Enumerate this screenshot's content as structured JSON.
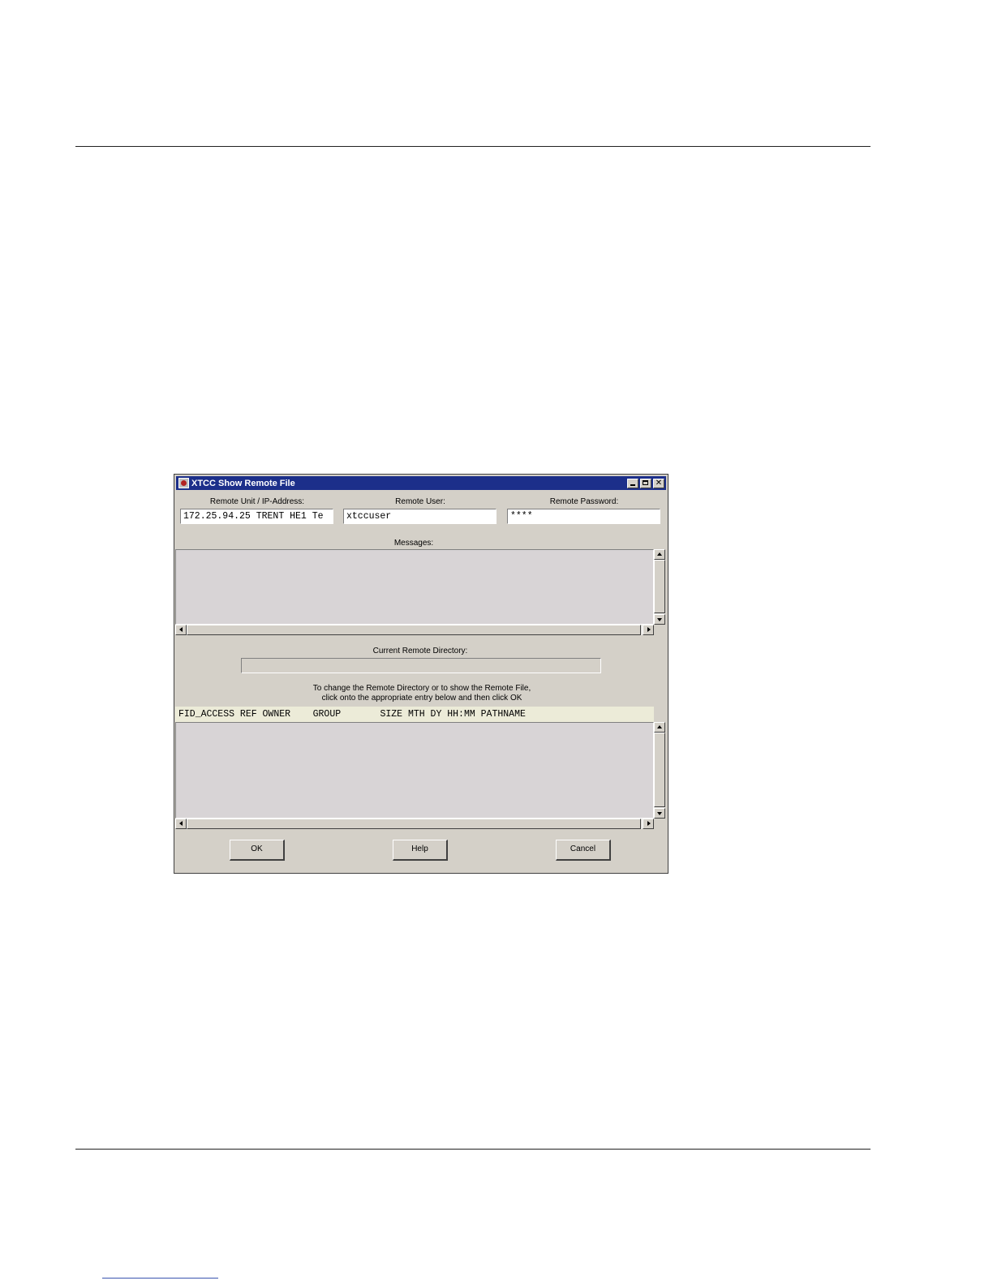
{
  "window": {
    "title": "XTCC Show Remote File"
  },
  "form": {
    "remote_unit_label": "Remote Unit / IP-Address:",
    "remote_unit_value": "172.25.94.25 TRENT HE1 Te",
    "remote_user_label": "Remote User:",
    "remote_user_value": "xtccuser",
    "remote_password_label": "Remote Password:",
    "remote_password_value": "****",
    "messages_label": "Messages:",
    "current_dir_label": "Current Remote Directory:",
    "current_dir_value": "",
    "instruction_line1": "To change the Remote Directory or to show the Remote File,",
    "instruction_line2": "click onto the appropriate entry below and then click OK"
  },
  "file_list": {
    "header": "FID_ACCESS REF OWNER    GROUP       SIZE MTH DY HH:MM PATHNAME",
    "rows": []
  },
  "buttons": {
    "ok": "OK",
    "help": "Help",
    "cancel": "Cancel"
  }
}
